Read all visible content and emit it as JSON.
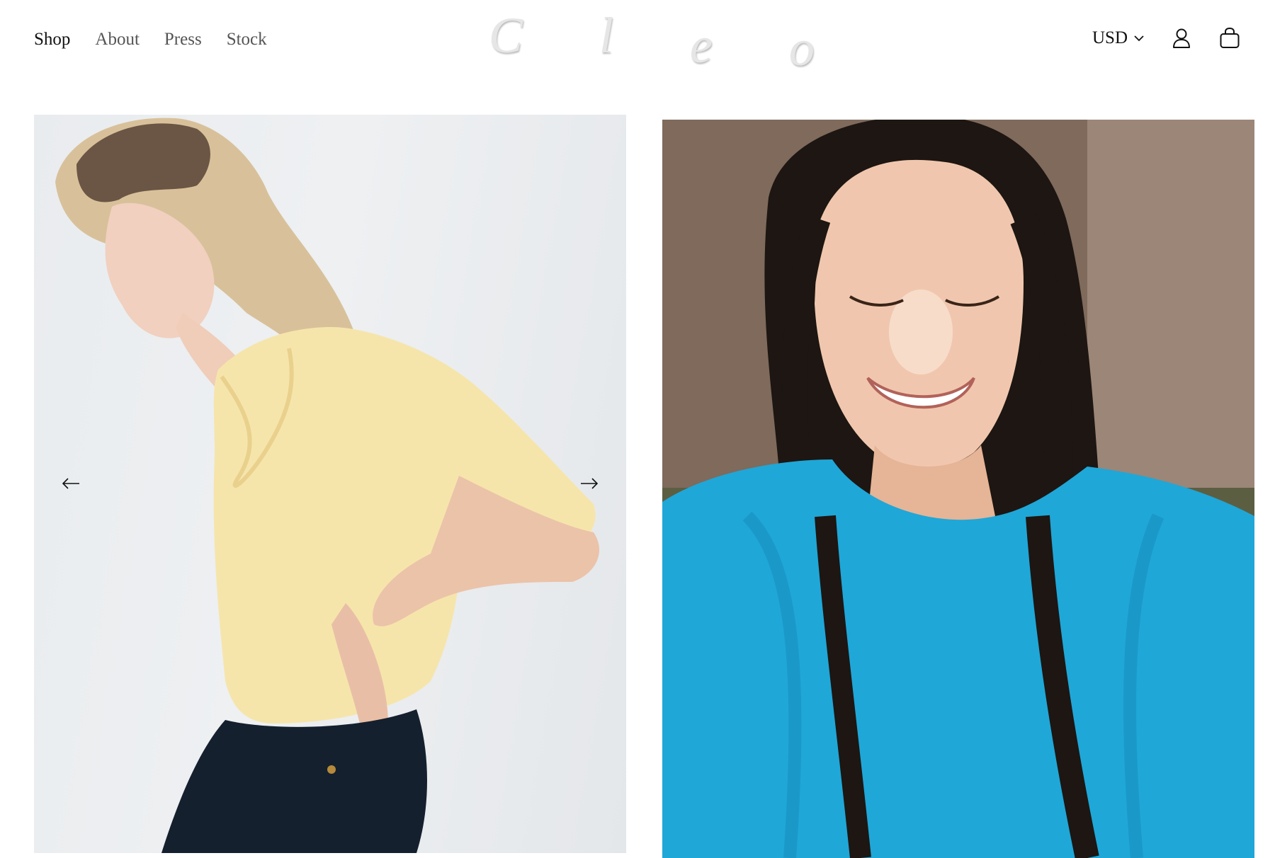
{
  "nav": {
    "items": [
      {
        "label": "Shop",
        "active": true
      },
      {
        "label": "About"
      },
      {
        "label": "Press"
      },
      {
        "label": "Stock"
      }
    ]
  },
  "brand": {
    "letters": [
      "C",
      "l",
      "e",
      "o"
    ]
  },
  "header_tools": {
    "currency": "USD",
    "icons": [
      "chevron-down-icon",
      "user-icon",
      "shopping-bag-icon"
    ]
  },
  "carousel": {
    "images": [
      {
        "alt": "Woman in pale yellow scoop-neck tee and dark jeans, looking down"
      },
      {
        "alt": "Smiling woman with long dark hair in bright blue long-sleeve top"
      }
    ],
    "controls": [
      "arrow-left-icon",
      "arrow-right-icon"
    ]
  },
  "colors": {
    "background": "#ffffff",
    "text": "#111111",
    "nav_inactive": "#555555",
    "yellow_tee": "#f7e7ae",
    "blue_top": "#1fa7d8",
    "denim": "#15202e"
  }
}
